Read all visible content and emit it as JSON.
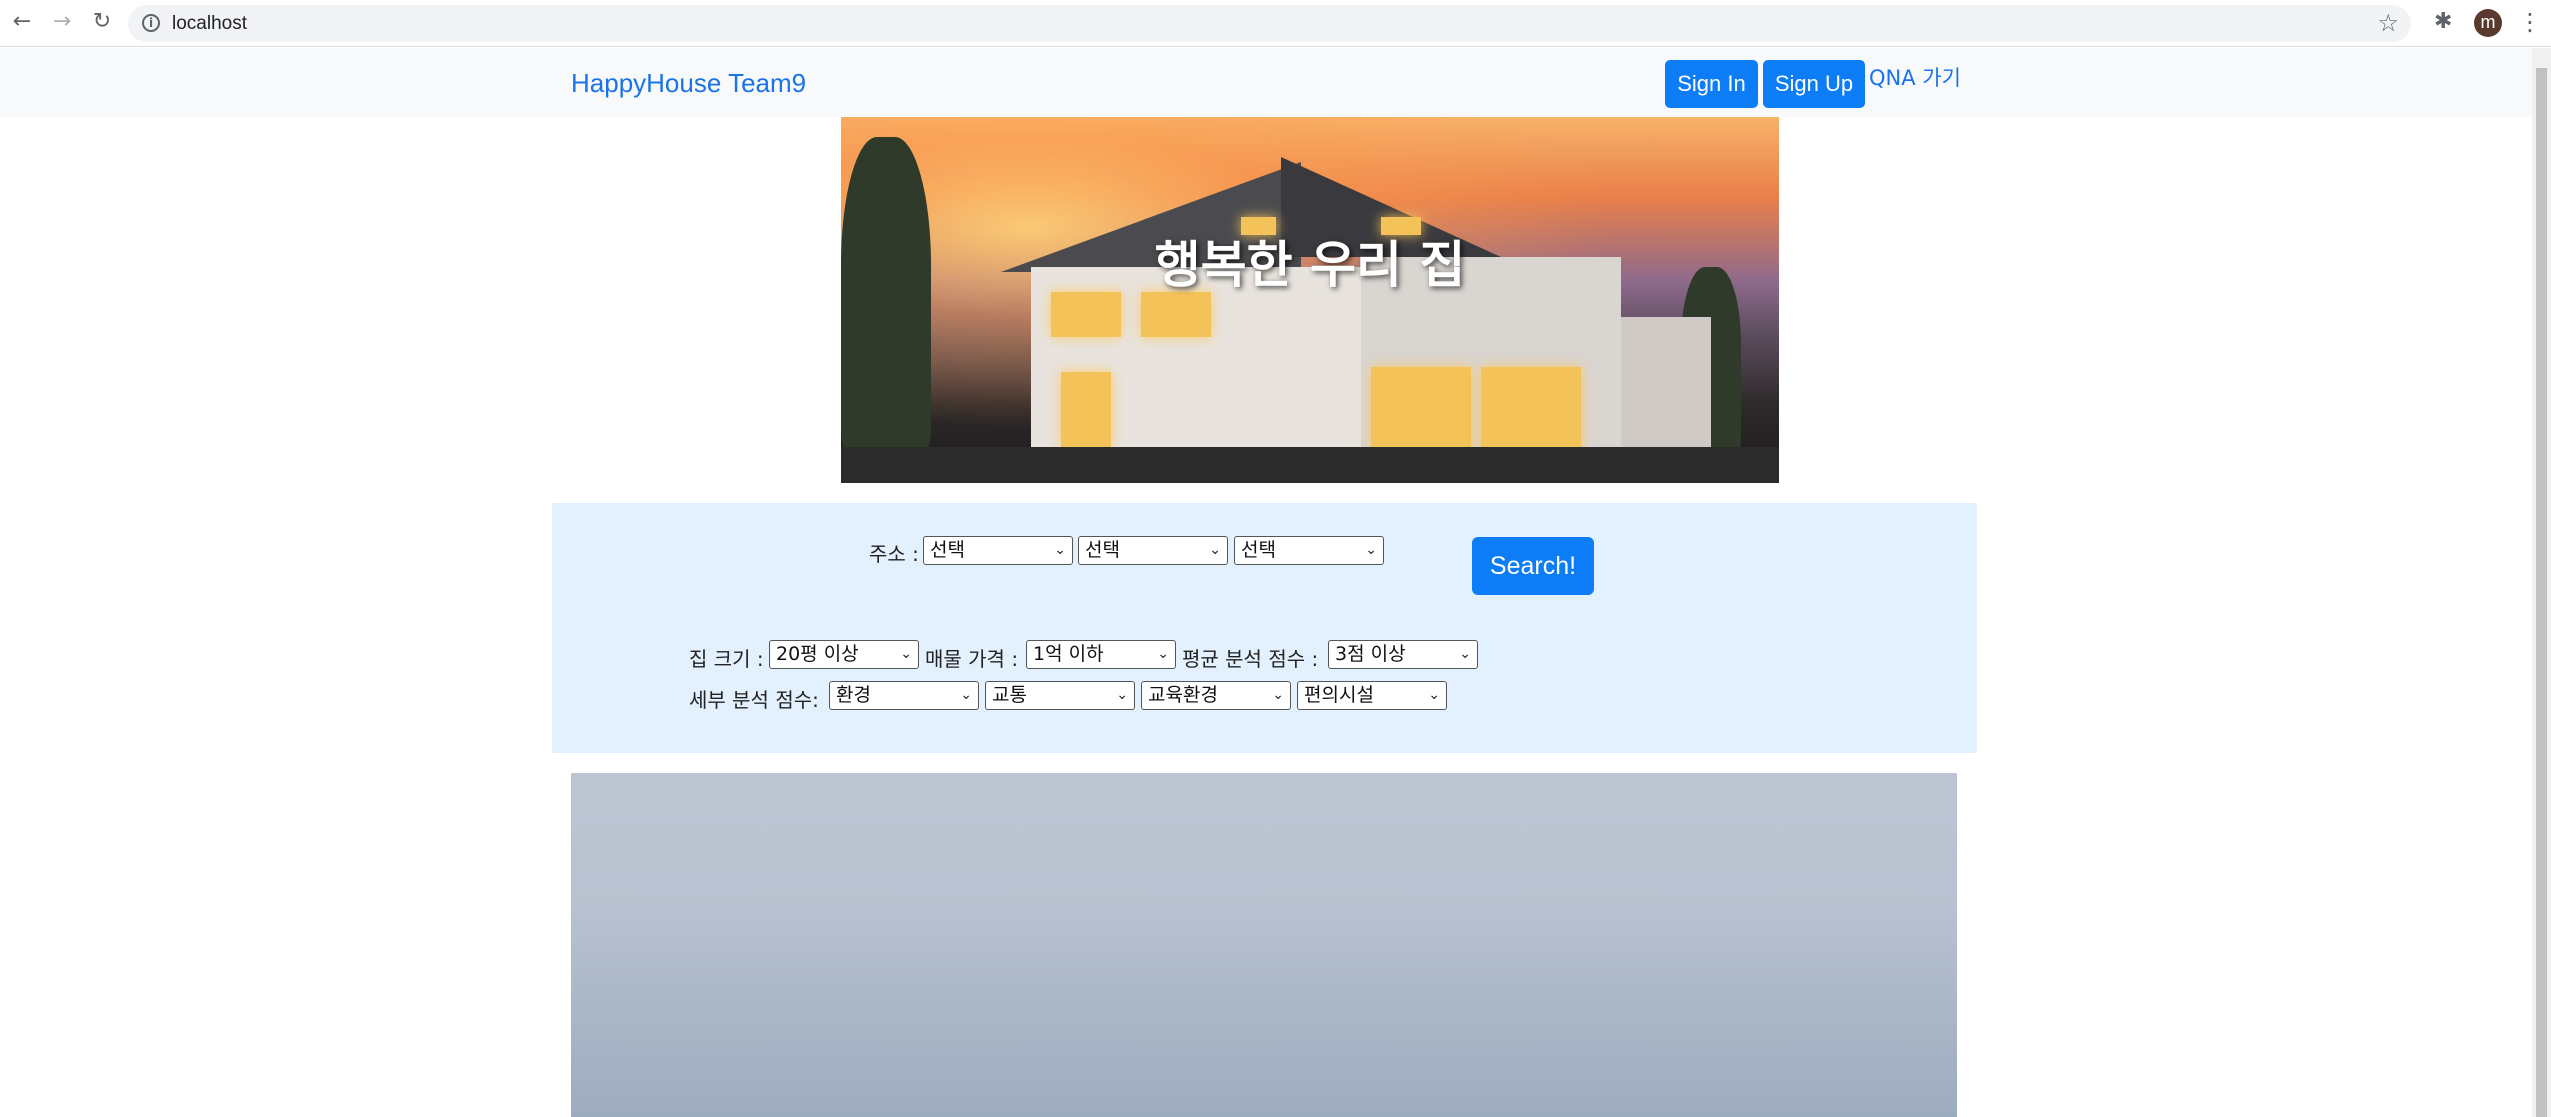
{
  "browser": {
    "url": "localhost",
    "avatar_letter": "m"
  },
  "navbar": {
    "brand": "HappyHouse Team9",
    "signin_label": "Sign In",
    "signup_label": "Sign Up",
    "qna_label": "QNA 가기"
  },
  "hero": {
    "title": "행복한 우리 집"
  },
  "search": {
    "address_label": "주소 :",
    "address_selects": [
      "선택",
      "선택",
      "선택"
    ],
    "search_button": "Search!",
    "house_size_label": "집 크기 :",
    "house_size_value": "20평 이상",
    "price_label": "매물 가격 :",
    "price_value": "1억 이하",
    "avg_score_label": "평균 분석 점수 :",
    "avg_score_value": "3점 이상",
    "detail_score_label": "세부 분석 점수:",
    "detail_selects": [
      "환경",
      "교통",
      "교육환경",
      "편의시설"
    ]
  },
  "colors": {
    "primary": "#0d7cf7",
    "link": "#1a73e8",
    "panel_bg": "#e3f0fd",
    "navbar_bg": "#f8f9fa"
  }
}
